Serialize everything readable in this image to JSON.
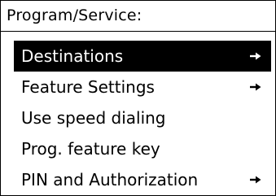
{
  "header": {
    "title": "Program/Service:"
  },
  "menu": {
    "items": [
      {
        "label": "Destinations",
        "submenu_icon": "arrow-right-icon",
        "selected": true
      },
      {
        "label": "Feature Settings",
        "submenu_icon": "arrow-right-icon",
        "selected": false
      },
      {
        "label": "Use speed dialing",
        "submenu_icon": null,
        "selected": false
      },
      {
        "label": "Prog. feature key",
        "submenu_icon": null,
        "selected": false
      },
      {
        "label": "PIN and Authorization",
        "submenu_icon": "arrow-right-icon",
        "selected": false
      }
    ]
  },
  "colors": {
    "background": "#ffffff",
    "foreground": "#000000",
    "selection_background": "#000000",
    "selection_foreground": "#ffffff"
  }
}
